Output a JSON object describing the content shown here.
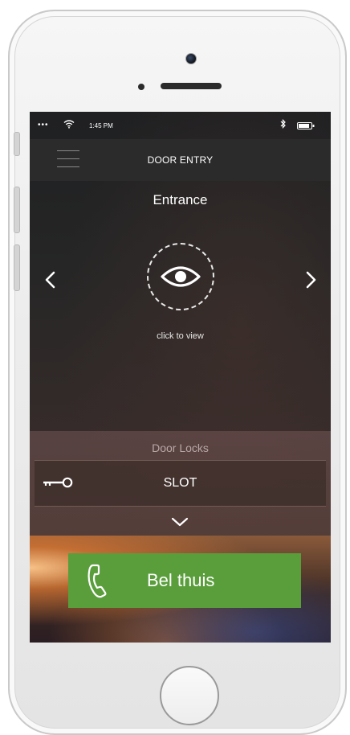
{
  "status_bar": {
    "signal": "•••",
    "time": "1:45 PM"
  },
  "header": {
    "title": "DOOR ENTRY",
    "menu_icon": "hamburger-menu-icon"
  },
  "camera_view": {
    "location": "Entrance",
    "caption": "click to view",
    "prev_icon": "chevron-left-icon",
    "next_icon": "chevron-right-icon",
    "view_icon": "eye-icon"
  },
  "door_locks": {
    "header": "Door Locks",
    "items": [
      {
        "label": "SLOT",
        "icon": "key-icon"
      }
    ],
    "expand_icon": "chevron-down-icon"
  },
  "call": {
    "label": "Bel thuis",
    "icon": "phone-handset-icon",
    "color": "#5a9e3c"
  },
  "colors": {
    "header_bg": "#2b2b2b",
    "text": "#ffffff"
  }
}
